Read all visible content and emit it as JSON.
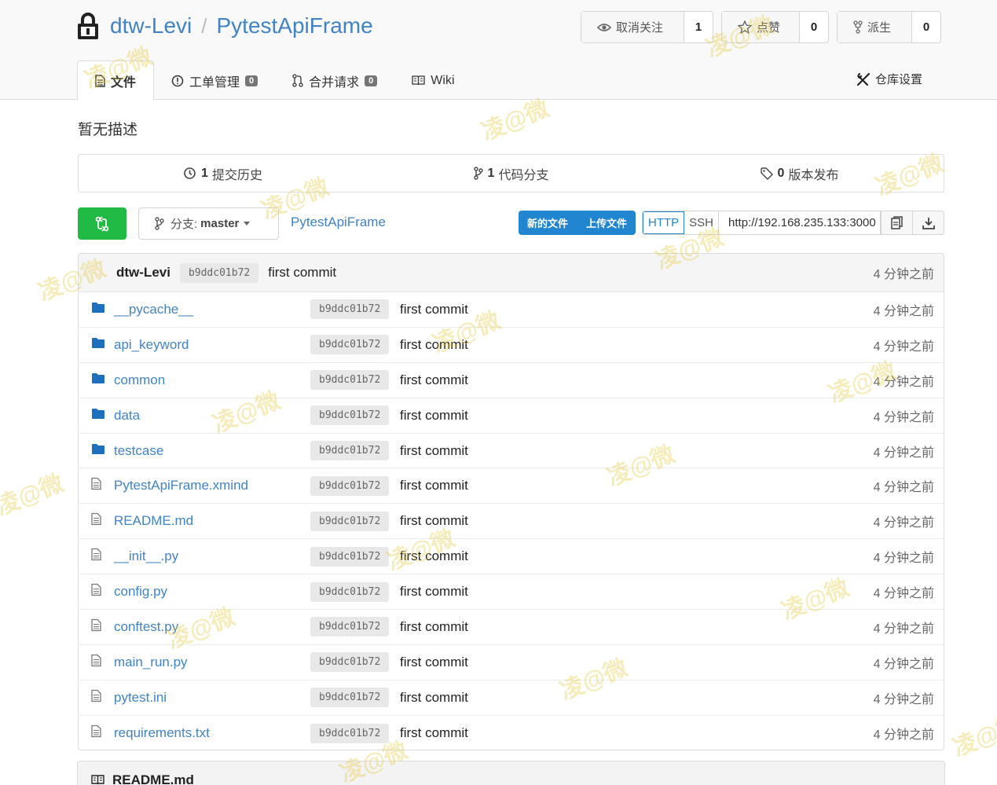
{
  "repo": {
    "owner": "dtw-Levi",
    "separator": "/",
    "name": "PytestApiFrame",
    "description": "暂无描述"
  },
  "actions": [
    {
      "label": "取消关注",
      "icon": "eye-icon",
      "count": "1"
    },
    {
      "label": "点赞",
      "icon": "star-icon",
      "count": "0"
    },
    {
      "label": "派生",
      "icon": "fork-icon",
      "count": "0"
    }
  ],
  "tabs": {
    "files": "文件",
    "issues": {
      "label": "工单管理",
      "badge": "0"
    },
    "pulls": {
      "label": "合并请求",
      "badge": "0"
    },
    "wiki": "Wiki",
    "settings": "仓库设置"
  },
  "stats": {
    "commits": {
      "count": "1",
      "label": "提交历史"
    },
    "branches": {
      "count": "1",
      "label": "代码分支"
    },
    "releases": {
      "count": "0",
      "label": "版本发布"
    }
  },
  "toolbar": {
    "branch_label": "分支:",
    "branch_name": "master",
    "repo_path": "PytestApiFrame",
    "new_file": "新的文件",
    "upload_file": "上传文件",
    "http": "HTTP",
    "ssh": "SSH",
    "clone_url": "http://192.168.235.133:3000"
  },
  "latest_commit": {
    "author": "dtw-Levi",
    "sha": "b9ddc01b72",
    "message": "first commit",
    "age": "4 分钟之前"
  },
  "files": [
    {
      "name": "__pycache__",
      "type": "folder",
      "sha": "b9ddc01b72",
      "message": "first commit",
      "age": "4 分钟之前"
    },
    {
      "name": "api_keyword",
      "type": "folder",
      "sha": "b9ddc01b72",
      "message": "first commit",
      "age": "4 分钟之前"
    },
    {
      "name": "common",
      "type": "folder",
      "sha": "b9ddc01b72",
      "message": "first commit",
      "age": "4 分钟之前"
    },
    {
      "name": "data",
      "type": "folder",
      "sha": "b9ddc01b72",
      "message": "first commit",
      "age": "4 分钟之前"
    },
    {
      "name": "testcase",
      "type": "folder",
      "sha": "b9ddc01b72",
      "message": "first commit",
      "age": "4 分钟之前"
    },
    {
      "name": "PytestApiFrame.xmind",
      "type": "file",
      "sha": "b9ddc01b72",
      "message": "first commit",
      "age": "4 分钟之前"
    },
    {
      "name": "README.md",
      "type": "file",
      "sha": "b9ddc01b72",
      "message": "first commit",
      "age": "4 分钟之前"
    },
    {
      "name": "__init__.py",
      "type": "file",
      "sha": "b9ddc01b72",
      "message": "first commit",
      "age": "4 分钟之前"
    },
    {
      "name": "config.py",
      "type": "file",
      "sha": "b9ddc01b72",
      "message": "first commit",
      "age": "4 分钟之前"
    },
    {
      "name": "conftest.py",
      "type": "file",
      "sha": "b9ddc01b72",
      "message": "first commit",
      "age": "4 分钟之前"
    },
    {
      "name": "main_run.py",
      "type": "file",
      "sha": "b9ddc01b72",
      "message": "first commit",
      "age": "4 分钟之前"
    },
    {
      "name": "pytest.ini",
      "type": "file",
      "sha": "b9ddc01b72",
      "message": "first commit",
      "age": "4 分钟之前"
    },
    {
      "name": "requirements.txt",
      "type": "file",
      "sha": "b9ddc01b72",
      "message": "first commit",
      "age": "4 分钟之前"
    }
  ],
  "readme": {
    "title": "README.md"
  },
  "watermark": "凌@微",
  "colors": {
    "link": "#4183c4",
    "primary": "#2185d0",
    "green": "#21ba45",
    "folder": "#1e70bf"
  }
}
